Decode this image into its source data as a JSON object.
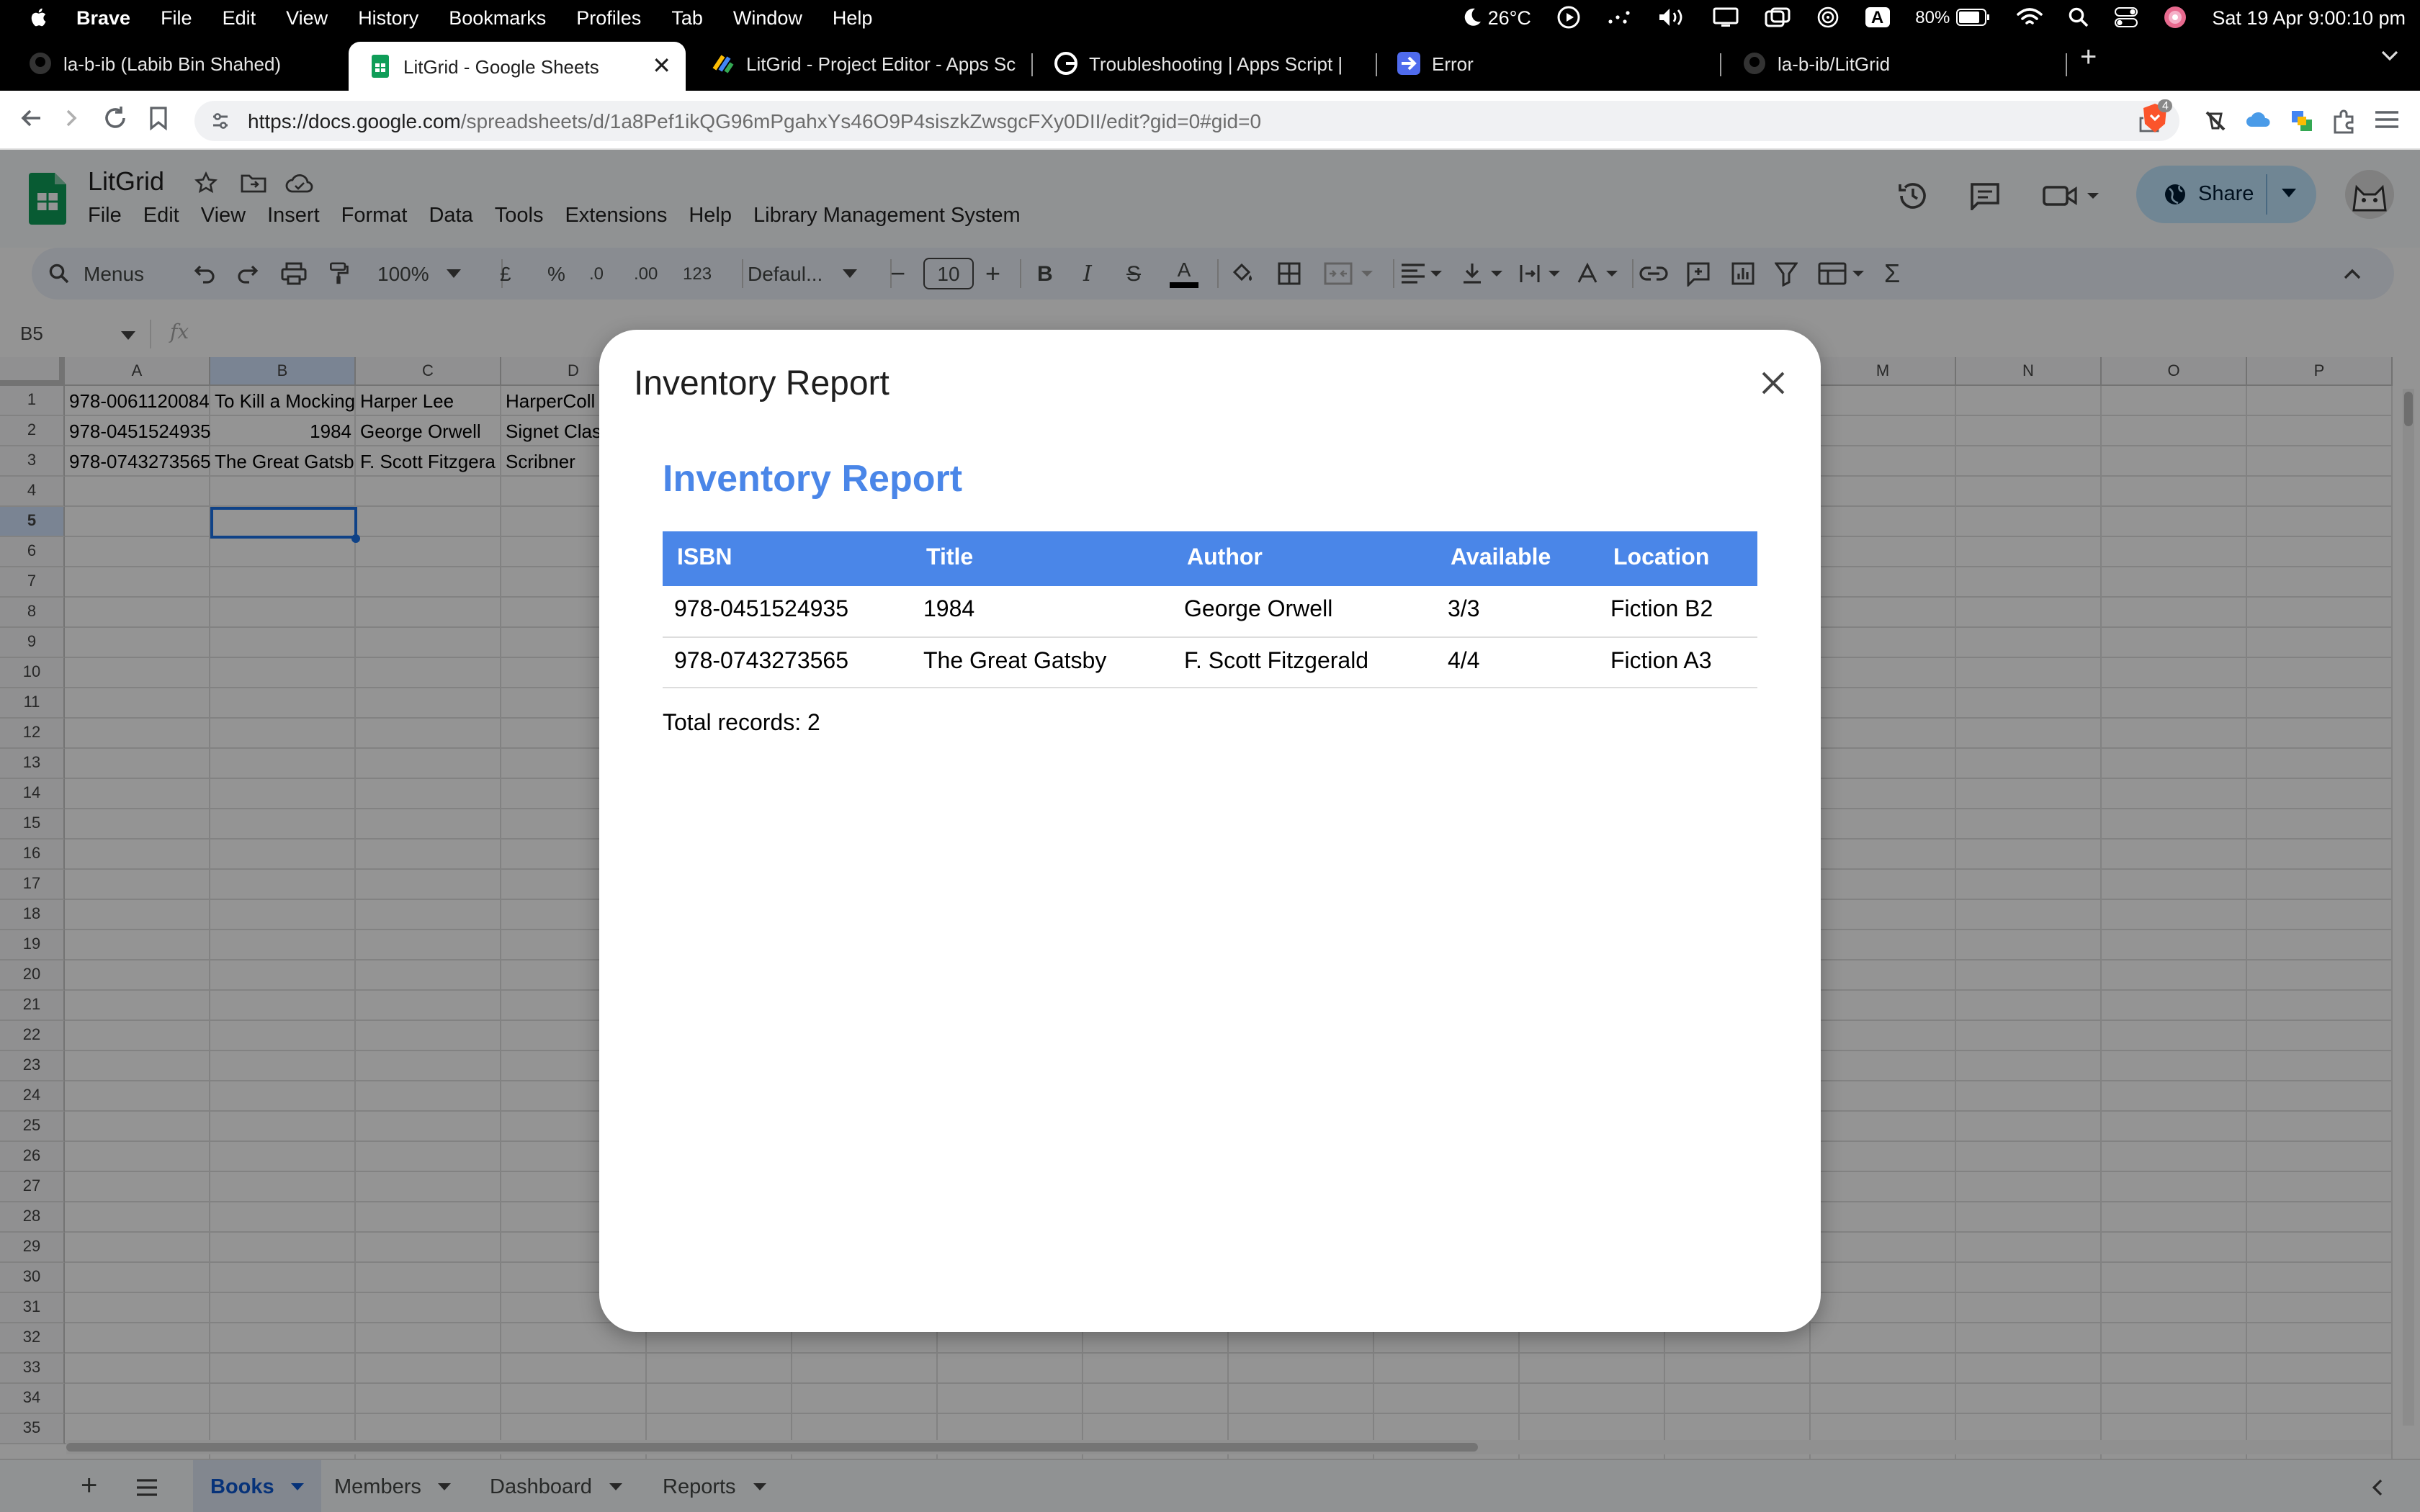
{
  "macbar": {
    "app": "Brave",
    "menus": [
      "File",
      "Edit",
      "View",
      "History",
      "Bookmarks",
      "Profiles",
      "Tab",
      "Window",
      "Help"
    ],
    "weather": "26°C",
    "battery": "80%",
    "datetime": "Sat 19 Apr  9:00:10 pm",
    "input_source": "A"
  },
  "tabs": [
    {
      "label": "la-b-ib (Labib Bin Shahed)"
    },
    {
      "label": "LitGrid - Google Sheets"
    },
    {
      "label": "LitGrid - Project Editor - Apps Sc"
    },
    {
      "label": "Troubleshooting  |  Apps Script  |"
    },
    {
      "label": "Error"
    },
    {
      "label": "la-b-ib/LitGrid"
    }
  ],
  "address": {
    "domain": "https://docs.google.com",
    "path": "/spreadsheets/d/1a8Pef1ikQG96mPgahxYs46O9P4siszkZwsgcFXy0DII/edit?gid=0#gid=0",
    "shields_count": "4"
  },
  "sheet": {
    "title": "LitGrid",
    "menus": [
      "File",
      "Edit",
      "View",
      "Insert",
      "Format",
      "Data",
      "Tools",
      "Extensions",
      "Help",
      "Library Management System"
    ],
    "share_label": "Share",
    "toolbar": {
      "search_label": "Menus",
      "zoom": "100%",
      "currency": "£",
      "percent": "%",
      "dec_down": ".0",
      "dec_up": ".00",
      "number_format": "123",
      "font": "Defaul...",
      "font_size": "10"
    },
    "name_box": "B5",
    "fx": "fx",
    "columns": [
      "A",
      "B",
      "C",
      "D",
      "M",
      "N",
      "O",
      "P"
    ],
    "rows": [
      "1",
      "2",
      "3",
      "4",
      "5",
      "6",
      "7",
      "8",
      "9",
      "10",
      "11",
      "12",
      "13",
      "14",
      "15",
      "16",
      "17",
      "18",
      "19",
      "20",
      "21",
      "22",
      "23",
      "24",
      "25",
      "26",
      "27",
      "28",
      "29",
      "30",
      "31",
      "32",
      "33",
      "34",
      "35"
    ],
    "cells": {
      "r1": [
        "978-0061120084",
        "To Kill a Mocking",
        "Harper Lee",
        "HarperColl"
      ],
      "r2": [
        "978-0451524935",
        "1984",
        "George Orwell",
        "Signet Clas"
      ],
      "r3": [
        "978-0743273565",
        "The Great Gatsb",
        "F. Scott Fitzgera",
        "Scribner"
      ]
    },
    "sheet_tabs": [
      "Books",
      "Members",
      "Dashboard",
      "Reports"
    ]
  },
  "modal": {
    "title": "Inventory Report",
    "heading": "Inventory Report",
    "columns": [
      "ISBN",
      "Title",
      "Author",
      "Available",
      "Location"
    ],
    "rows": [
      [
        "978-0451524935",
        "1984",
        "George Orwell",
        "3/3",
        "Fiction B2"
      ],
      [
        "978-0743273565",
        "The Great Gatsby",
        "F. Scott Fitzgerald",
        "4/4",
        "Fiction A3"
      ]
    ],
    "total": "Total records: 2"
  },
  "colors": {
    "accent_blue": "#4a86e8",
    "share_bg": "#c2e7ff",
    "sheets_green": "#0f9d58"
  }
}
